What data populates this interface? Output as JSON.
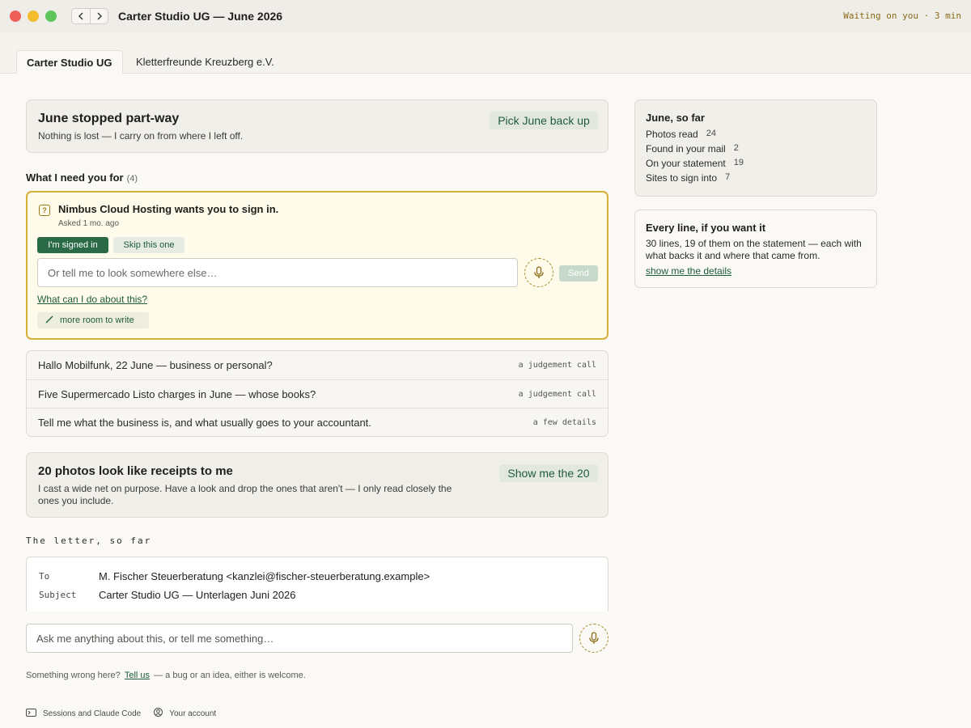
{
  "window": {
    "title": "Carter Studio UG — June 2026",
    "status": "Waiting on you · 3 min"
  },
  "tabs": [
    {
      "label": "Carter Studio UG",
      "active": true
    },
    {
      "label": "Kletterfreunde Kreuzberg e.V.",
      "active": false
    }
  ],
  "resume": {
    "title": "June stopped part-way",
    "subtitle": "Nothing is lost — I carry on from where I left off.",
    "button": "Pick June back up"
  },
  "needs": {
    "heading": "What I need you for",
    "count": "(4)",
    "active_question": {
      "text": "Nimbus Cloud Hosting wants you to sign in.",
      "asked": "Asked 1 mo. ago",
      "primary_button": "I'm signed in",
      "skip_button": "Skip this one",
      "input_placeholder": "Or tell me to look somewhere else…",
      "send_button": "Send",
      "help_link": "What can I do about this?",
      "more_room": "more room to write"
    },
    "items": [
      {
        "text": "Hallo Mobilfunk, 22 June — business or personal?",
        "tag": "a judgement call"
      },
      {
        "text": "Five Supermercado Listo charges in June — whose books?",
        "tag": "a judgement call"
      },
      {
        "text": "Tell me what the business is, and what usually goes to your accountant.",
        "tag": "a few details"
      }
    ]
  },
  "receipts": {
    "title": "20 photos look like receipts to me",
    "body": "I cast a wide net on purpose. Have a look and drop the ones that aren't — I only read closely the ones you include.",
    "button": "Show me the 20"
  },
  "letter": {
    "label": "The letter, so far",
    "to_label": "To",
    "to_value": "M. Fischer Steuerberatung <kanzlei@fischer-steuerberatung.example>",
    "subject_label": "Subject",
    "subject_value": "Carter Studio UG — Unterlagen Juni 2026"
  },
  "chat": {
    "placeholder": "Ask me anything about this, or tell me something…"
  },
  "feedback": {
    "prefix": "Something wrong here?",
    "link": "Tell us",
    "suffix": "— a bug or an idea, either is welcome."
  },
  "footer": {
    "sessions": "Sessions and Claude Code",
    "account": "Your account"
  },
  "sidebar": {
    "stats": {
      "title": "June, so far",
      "rows": [
        {
          "label": "Photos read",
          "value": "24"
        },
        {
          "label": "Found in your mail",
          "value": "2"
        },
        {
          "label": "On your statement",
          "value": "19"
        },
        {
          "label": "Sites to sign into",
          "value": "7"
        }
      ]
    },
    "lines": {
      "title": "Every line, if you want it",
      "body": "30 lines, 19 of them on the statement — each with what backs it and where that came from.",
      "link": "show me the details"
    }
  },
  "colors": {
    "accent_green": "#2a6a47",
    "highlight_border": "#d4b23a",
    "status_text": "#8a6a14"
  },
  "icons": [
    "back-icon",
    "forward-icon",
    "question-icon",
    "microphone-icon",
    "pencil-icon",
    "sessions-icon",
    "account-icon"
  ]
}
